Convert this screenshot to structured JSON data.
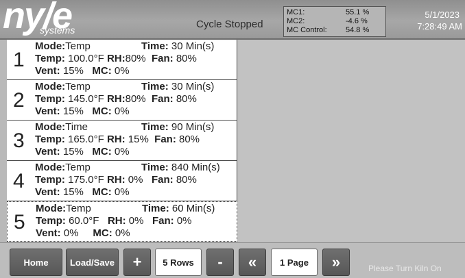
{
  "header": {
    "logo_text": "ny/e",
    "logo_sub": "systems",
    "cycle_status": "Cycle Stopped",
    "mc": [
      {
        "label": "MC1:",
        "value": "55.1 %"
      },
      {
        "label": "MC2:",
        "value": "-4.6 %"
      },
      {
        "label": "MC Control:",
        "value": "54.8 %"
      }
    ],
    "date": "5/1/2023",
    "time": "7:28:49 AM"
  },
  "labels": {
    "mode": "Mode:",
    "time": "Time:",
    "temp": "Temp:",
    "rh": "RH:",
    "fan": "Fan:",
    "vent": "Vent:",
    "mc": "MC:"
  },
  "steps": [
    {
      "num": "1",
      "mode": "Temp",
      "time": "30 Min(s)",
      "temp": "100.0°F",
      "rh": "80%",
      "fan": "80%",
      "vent": "15%",
      "mc": "0%"
    },
    {
      "num": "2",
      "mode": "Temp",
      "time": "30 Min(s)",
      "temp": "145.0°F",
      "rh": "80%",
      "fan": "80%",
      "vent": "15%",
      "mc": "0%"
    },
    {
      "num": "3",
      "mode": "Time",
      "time": "90 Min(s)",
      "temp": "165.0°F",
      "rh": "15%",
      "fan": "80%",
      "vent": "15%",
      "mc": "0%"
    },
    {
      "num": "4",
      "mode": "Temp",
      "time": "840 Min(s)",
      "temp": "175.0°F",
      "rh": "0%",
      "fan": "80%",
      "vent": "15%",
      "mc": "0%"
    },
    {
      "num": "5",
      "mode": "Temp",
      "time": "60 Min(s)",
      "temp": "60.0°F",
      "rh": "0%",
      "fan": "0%",
      "vent": "0%",
      "mc": "0%"
    }
  ],
  "footer": {
    "home": "Home",
    "load_save": "Load/Save",
    "add": "+",
    "rows": "5 Rows",
    "remove": "-",
    "prev": "«",
    "page": "1 Page",
    "next": "»",
    "message": "Please Turn Kiln On"
  }
}
